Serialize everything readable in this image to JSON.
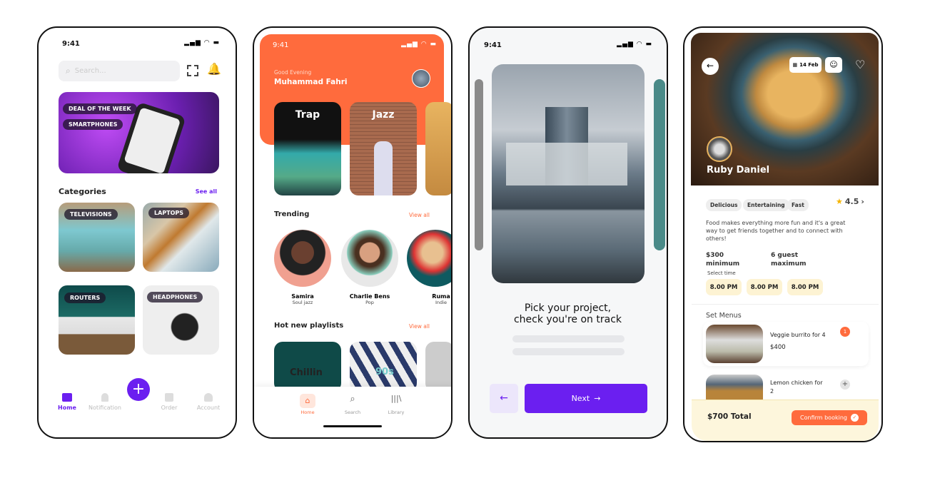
{
  "shop": {
    "time": "9:41",
    "search_placeholder": "Search...",
    "banner_tags": [
      "DEAL OF THE WEEK",
      "SMARTPHONES"
    ],
    "categories_title": "Categories",
    "see_all": "See all",
    "categories": [
      "TELEVISIONS",
      "LAPTOPS",
      "ROUTERS",
      "HEADPHONES"
    ],
    "nav": [
      "Home",
      "Notification",
      "Order",
      "Account"
    ],
    "accent": "#6b1ff0"
  },
  "music": {
    "time": "9:41",
    "greeting": "Good Evening",
    "user": "Muhammad Fahri",
    "genres": [
      "Trap",
      "Jazz"
    ],
    "trending_title": "Trending",
    "view_all": "View all",
    "artists": [
      {
        "name": "Samira",
        "genre": "Soul jazz"
      },
      {
        "name": "Charlie Bens",
        "genre": "Pop"
      },
      {
        "name": "Ruma",
        "genre": "Indie"
      }
    ],
    "playlists_title": "Hot new playlists",
    "playlists": [
      "Chillin",
      "90s"
    ],
    "nav": [
      "Home",
      "Search",
      "Library"
    ],
    "accent": "#ff6b3d"
  },
  "project": {
    "time": "9:41",
    "title_line1": "Pick your project,",
    "title_line2": "check you're on track",
    "next_label": "Next",
    "accent": "#6b1ff0"
  },
  "food": {
    "date": "14 Feb",
    "host": "Ruby Daniel",
    "tags": [
      "Delicious",
      "Entertaining",
      "Fast"
    ],
    "rating": "4.5",
    "description": "Food makes everything more fun and it's a great way to get friends together and to connect with others!",
    "min_price": "$300",
    "min_label": "minimum",
    "guests": "6 guest",
    "guests_label": "maximum",
    "select_time": "Select time",
    "times": [
      "8.00 PM",
      "8.00 PM",
      "8.00 PM"
    ],
    "set_menus": "Set Menus",
    "menus": [
      {
        "name": "Veggie burrito for 4",
        "price": "$400",
        "badge": "1"
      },
      {
        "name": "Lemon chicken for 2"
      }
    ],
    "total": "$700 Total",
    "confirm": "Confirm booking",
    "accent": "#ff6b3d"
  }
}
